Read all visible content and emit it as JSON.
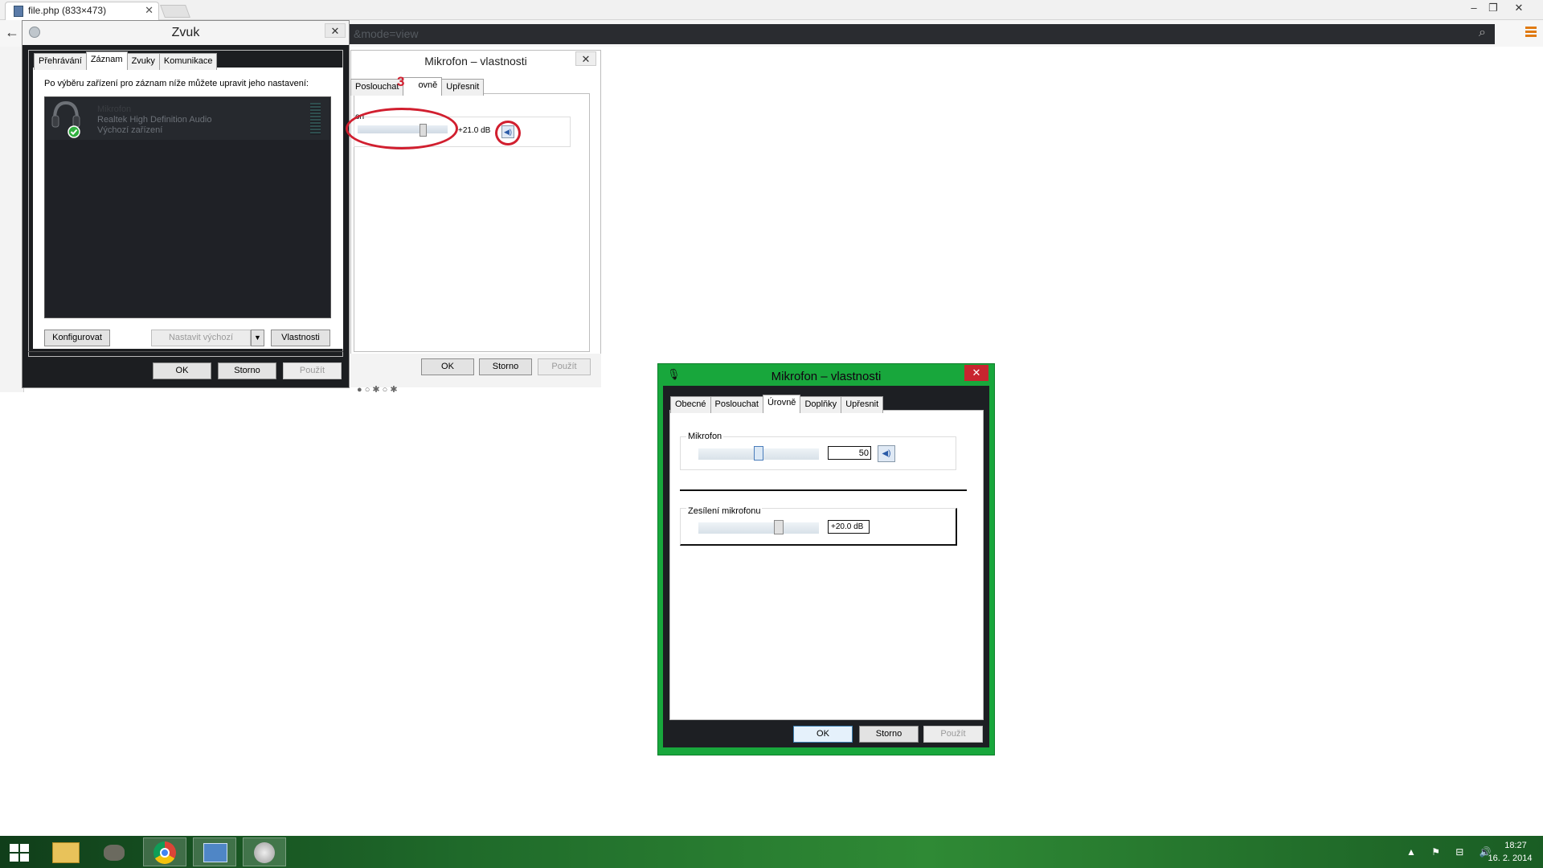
{
  "browser": {
    "tab_title": "file.php (833×473)",
    "address_fragment": "&mode=view",
    "window_controls": [
      "–",
      "❐",
      "✕"
    ]
  },
  "zvuk": {
    "title": "Zvuk",
    "tabs": [
      "Přehrávání",
      "Záznam",
      "Zvuky",
      "Komunikace"
    ],
    "active_tab": "Záznam",
    "instruction": "Po výběru zařízení pro záznam níže můžete upravit jeho nastavení:",
    "device": {
      "name": "Mikrofon",
      "driver": "Realtek High Definition Audio",
      "status": "Výchozí zařízení"
    },
    "buttons": {
      "configure": "Konfigurovat",
      "set_default": "Nastavit výchozí",
      "properties": "Vlastnosti",
      "ok": "OK",
      "cancel": "Storno",
      "apply": "Použít"
    }
  },
  "mic_back": {
    "title": "Mikrofon – vlastnosti",
    "tabs": [
      "Poslouchat",
      "Úrovně",
      "Upřesnit"
    ],
    "tab_partial": "ovně",
    "group_label_partial": "on",
    "db_value": "+21.0 dB",
    "annotation_number": "3",
    "buttons": {
      "ok": "OK",
      "cancel": "Storno",
      "apply": "Použít"
    }
  },
  "mic_front": {
    "title": "Mikrofon – vlastnosti",
    "tabs": [
      "Obecné",
      "Poslouchat",
      "Úrovně",
      "Doplňky",
      "Upřesnit"
    ],
    "active_tab": "Úrovně",
    "mic_group_label": "Mikrofon",
    "mic_value": "50",
    "mic_level": 0.5,
    "gain_group_label": "Zesílení mikrofonu",
    "gain_value": "+20.0 dB",
    "gain_level": 0.67,
    "buttons": {
      "ok": "OK",
      "cancel": "Storno",
      "apply": "Použít"
    }
  },
  "taskbar": {
    "time": "18:27",
    "date": "16. 2. 2014",
    "tray": "▲ ⚑ ⊟ 🔊"
  },
  "colors": {
    "accent_green": "#18a73c",
    "close_red": "#c8252f",
    "annotation_red": "#d11f2f"
  }
}
